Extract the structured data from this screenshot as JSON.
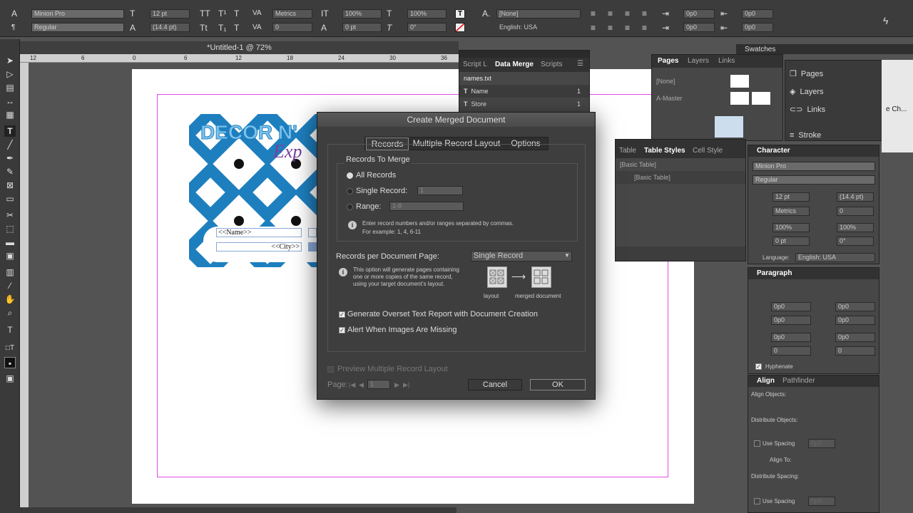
{
  "control_panel": {
    "font_family": "Minion Pro",
    "font_style": "Regular",
    "font_size": "12 pt",
    "leading": "(14.4 pt)",
    "kerning": "Metrics",
    "tracking": "0",
    "vscale": "100%",
    "hscale": "100%",
    "baseline": "0 pt",
    "skew": "0°",
    "char_style": "[None]",
    "language": "English: USA",
    "indent1": "0p0",
    "indent2": "0p0",
    "indent3": "0p0",
    "indent4": "0p0"
  },
  "document": {
    "tab_title": "*Untitled-1 @ 72%",
    "ruler_marks": [
      "12",
      "6",
      "0",
      "6",
      "12",
      "18",
      "24",
      "30",
      "36"
    ],
    "banner_text": "DECOR N'",
    "script_text": "Exp",
    "name_field": "<<Name>>",
    "city_field": "<<City>>"
  },
  "data_merge_panel": {
    "tabs": [
      "Script L",
      "Data Merge",
      "Scripts"
    ],
    "file": "names.txt",
    "fields": [
      {
        "name": "Name",
        "value": "1"
      },
      {
        "name": "Store",
        "value": "1"
      }
    ]
  },
  "pages_panel": {
    "tabs": [
      "Pages",
      "Layers",
      "Links"
    ],
    "rows": [
      "[None]",
      "A-Master"
    ]
  },
  "swatches_label": "Swatches",
  "dock_items": [
    "Pages",
    "Layers",
    "Links",
    "Stroke"
  ],
  "cut_label": "e Ch...",
  "table_styles_panel": {
    "tabs": [
      "Table",
      "Table Styles",
      "Cell Style"
    ],
    "header_row": "[Basic Table]",
    "item": "[Basic Table]"
  },
  "character_panel": {
    "title": "Character",
    "font": "Minion Pro",
    "style": "Regular",
    "size": "12 pt",
    "leading": "(14.4 pt)",
    "kerning": "Metrics",
    "tracking": "0",
    "vscale": "100%",
    "hscale": "100%",
    "baseline": "0 pt",
    "skew": "0°",
    "language_label": "Language:",
    "language": "English: USA"
  },
  "paragraph_panel": {
    "title": "Paragraph",
    "values": [
      "0p0",
      "0p0",
      "0p0",
      "0p0",
      "0p0",
      "0p0",
      "0",
      "0"
    ],
    "hyphenate": "Hyphenate"
  },
  "align_panel": {
    "tabs": [
      "Align",
      "Pathfinder"
    ],
    "align_objects": "Align Objects:",
    "distribute_objects": "Distribute Objects:",
    "use_spacing": "Use Spacing",
    "spacing_value": "0p0",
    "align_to": "Align To:",
    "distribute_spacing": "Distribute Spacing:",
    "use_spacing2": "Use Spacing",
    "spacing_value2": "0p0"
  },
  "dialog": {
    "title": "Create Merged Document",
    "tabs": [
      "Records",
      "Multiple Record Layout",
      "Options"
    ],
    "group_title": "Records To Merge",
    "all_records": "All Records",
    "single_record": "Single Record:",
    "single_record_value": "1",
    "range": "Range:",
    "range_value": "1-8",
    "range_info": "Enter record numbers and/or ranges separated by commas. For example: 1, 4, 6-11",
    "per_page_label": "Records per Document Page:",
    "per_page_value": "Single Record",
    "per_page_info": "This option will generate pages containing one or more copies of the same record, using your target document's layout.",
    "layout_label": "layout",
    "merged_label": "merged document",
    "overset_label": "Generate Overset Text Report with Document Creation",
    "missing_label": "Alert When Images Are Missing",
    "preview_label": "Preview Multiple Record Layout",
    "page_label": "Page:",
    "page_value": "1",
    "cancel": "Cancel",
    "ok": "OK"
  },
  "colors": {
    "accent_blue": "#1e7fbf",
    "guide_magenta": "#e14be1"
  }
}
